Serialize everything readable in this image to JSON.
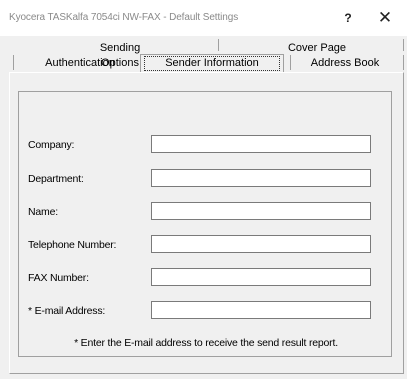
{
  "window": {
    "title": "Kyocera TASKalfa 7054ci NW-FAX - Default Settings",
    "help_label": "?",
    "close_label": "✕"
  },
  "tabs": {
    "row_back": [
      {
        "label": "Sending Options"
      },
      {
        "label": "Cover Page"
      }
    ],
    "row_front": [
      {
        "label": "Authentication"
      },
      {
        "label": "Sender Information",
        "selected": true
      },
      {
        "label": "Address Book"
      }
    ]
  },
  "form": {
    "fields": [
      {
        "label": "Company:",
        "value": ""
      },
      {
        "label": "Department:",
        "value": ""
      },
      {
        "label": "Name:",
        "value": ""
      },
      {
        "label": "Telephone Number:",
        "value": ""
      },
      {
        "label": "FAX Number:",
        "value": ""
      },
      {
        "label": "* E-mail Address:",
        "value": ""
      }
    ],
    "note": "* Enter the E-mail address to receive the send result report."
  }
}
